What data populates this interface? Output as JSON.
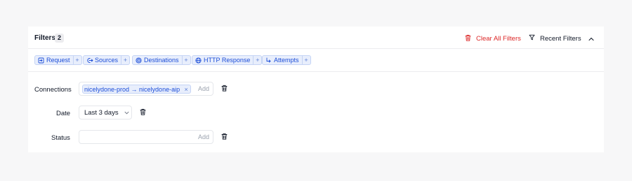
{
  "header": {
    "title": "Filters",
    "count": "2",
    "clear_all_label": "Clear All Filters",
    "recent_label": "Recent Filters"
  },
  "filter_types": [
    {
      "label": "Request",
      "icon": "request-icon"
    },
    {
      "label": "Sources",
      "icon": "sources-icon"
    },
    {
      "label": "Destinations",
      "icon": "destinations-icon"
    },
    {
      "label": "HTTP Response",
      "icon": "globe-icon"
    },
    {
      "label": "Attempts",
      "icon": "attempts-arrow-icon"
    }
  ],
  "rows": {
    "connections": {
      "label": "Connections",
      "value_chip": "nicelydone-prod → nicelydone-aip",
      "add_placeholder": "Add"
    },
    "date": {
      "label": "Date",
      "value": "Last 3 days"
    },
    "status": {
      "label": "Status",
      "add_placeholder": "Add"
    }
  },
  "colors": {
    "accent": "#1d4ed8",
    "chip_bg": "#e8eefc",
    "danger": "#dc2626"
  }
}
